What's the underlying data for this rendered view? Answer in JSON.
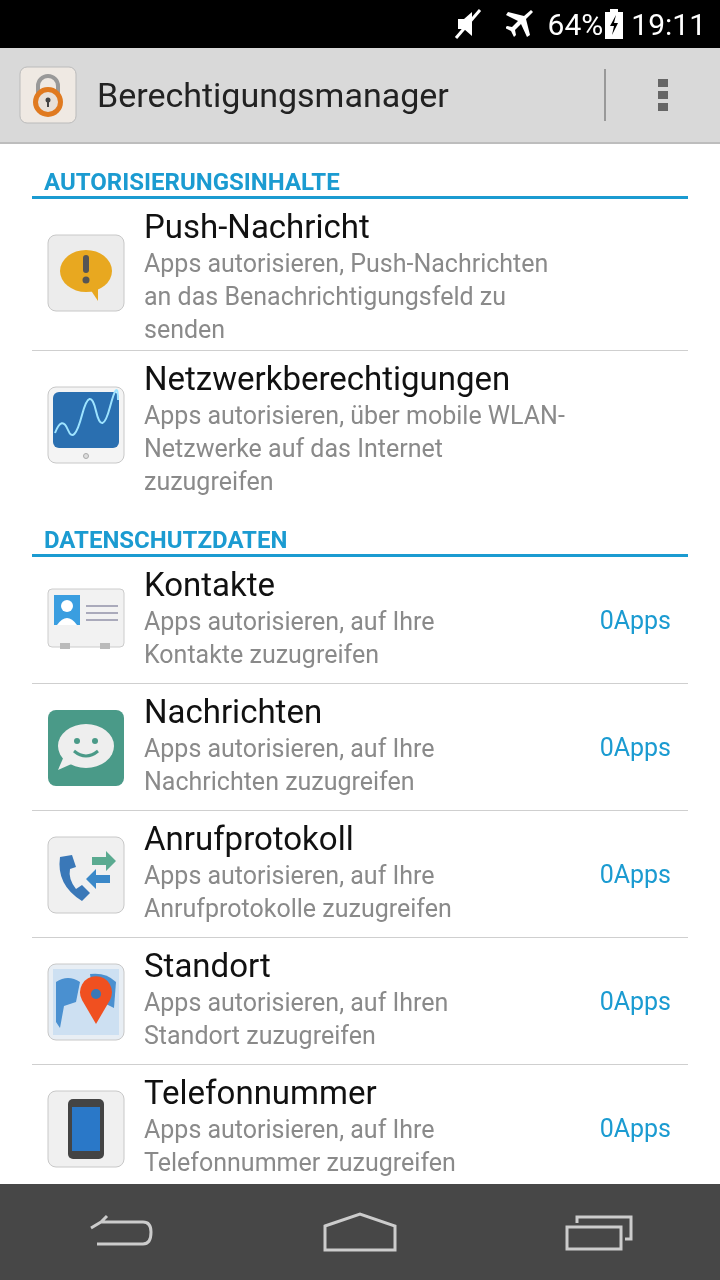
{
  "status_bar": {
    "battery": "64%",
    "time": "19:11"
  },
  "action_bar": {
    "title": "Berechtigungsmanager"
  },
  "sections": [
    {
      "title": "AUTORISIERUNGSINHALTE",
      "items": [
        {
          "title": "Push-Nachricht",
          "description": "Apps autorisieren, Push-Nachrichten an das Benachrichtigungsfeld zu senden"
        },
        {
          "title": "Netzwerkberechtigungen",
          "description": "Apps autorisieren, über mobile WLAN-Netzwerke auf das Internet zuzugreifen"
        }
      ]
    },
    {
      "title": "DATENSCHUTZDATEN",
      "items": [
        {
          "title": "Kontakte",
          "description": "Apps autorisieren, auf Ihre Kontakte zuzugreifen",
          "count": "0Apps"
        },
        {
          "title": "Nachrichten",
          "description": "Apps autorisieren, auf Ihre Nachrichten zuzugreifen",
          "count": "0Apps"
        },
        {
          "title": "Anrufprotokoll",
          "description": "Apps autorisieren, auf Ihre Anrufprotokolle zuzugreifen",
          "count": "0Apps"
        },
        {
          "title": "Standort",
          "description": "Apps autorisieren, auf Ihren Standort zuzugreifen",
          "count": "0Apps"
        },
        {
          "title": "Telefonnummer",
          "description": "Apps autorisieren, auf Ihre Telefonnummer zuzugreifen",
          "count": "0Apps"
        }
      ]
    }
  ]
}
